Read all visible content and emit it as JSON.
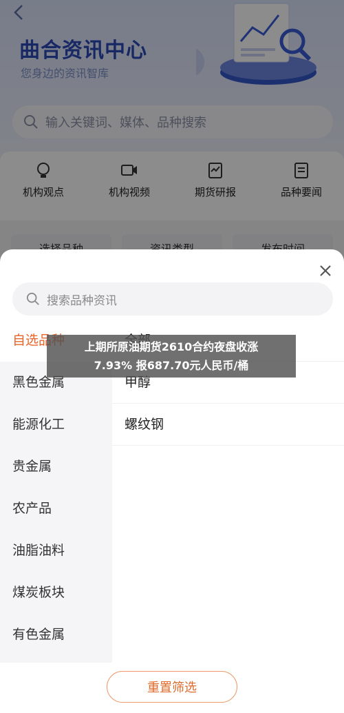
{
  "hero": {
    "title": "曲合资讯中心",
    "subtitle": "您身边的资讯智库",
    "search_placeholder": "输入关键词、媒体、品种搜索"
  },
  "quick_links": [
    {
      "label": "机构观点",
      "icon": "lightbulb-icon"
    },
    {
      "label": "机构视频",
      "icon": "video-icon"
    },
    {
      "label": "期货研报",
      "icon": "report-icon"
    },
    {
      "label": "品种要闻",
      "icon": "news-icon"
    }
  ],
  "filters": [
    {
      "label": "选择品种"
    },
    {
      "label": "资讯类型"
    },
    {
      "label": "发布时间"
    }
  ],
  "sheet": {
    "search_placeholder": "搜索品种资讯",
    "categories": [
      "自选品种",
      "黑色金属",
      "能源化工",
      "贵金属",
      "农产品",
      "油脂油料",
      "煤炭板块",
      "有色金属"
    ],
    "active_category": "自选品种",
    "sub_items": [
      "全部",
      "甲醇",
      "螺纹钢"
    ],
    "reset_label": "重置筛选"
  },
  "headline": {
    "line1": "上期所原油期货2610合约夜盘收涨",
    "line2": "7.93% 报687.70元人民币/桶"
  },
  "colors": {
    "brand": "#2a49b7",
    "accent": "#e8652a"
  }
}
